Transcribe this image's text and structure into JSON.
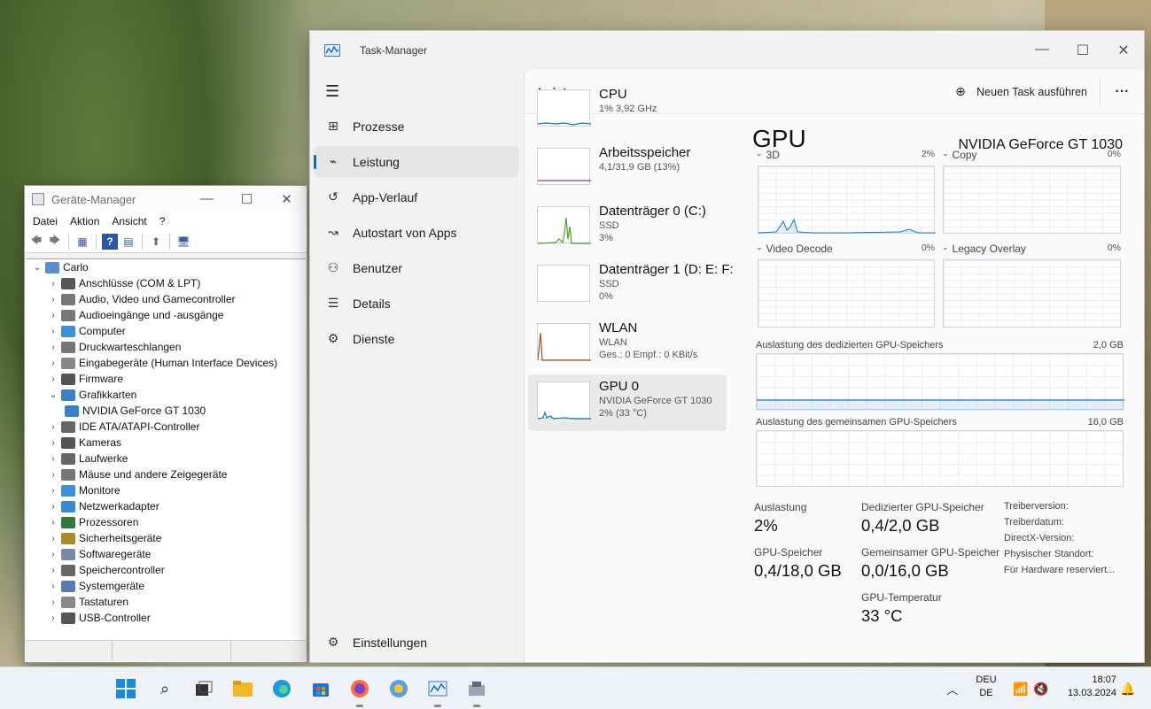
{
  "devmgr": {
    "title": "Geräte-Manager",
    "menu": [
      "Datei",
      "Aktion",
      "Ansicht",
      "?"
    ],
    "tree": [
      {
        "label": "Carlo",
        "level": 0,
        "expanded": true,
        "icon": "computer-icon"
      },
      {
        "label": "Anschlüsse (COM & LPT)",
        "level": 1,
        "icon": "port-icon"
      },
      {
        "label": "Audio, Video und Gamecontroller",
        "level": 1,
        "icon": "speaker-icon"
      },
      {
        "label": "Audioeingänge und -ausgänge",
        "level": 1,
        "icon": "speaker-icon"
      },
      {
        "label": "Computer",
        "level": 1,
        "icon": "monitor-icon"
      },
      {
        "label": "Druckwarteschlangen",
        "level": 1,
        "icon": "printer-icon"
      },
      {
        "label": "Eingabegeräte (Human Interface Devices)",
        "level": 1,
        "icon": "keyboard-icon"
      },
      {
        "label": "Firmware",
        "level": 1,
        "icon": "chip-icon"
      },
      {
        "label": "Grafikkarten",
        "level": 1,
        "expanded": true,
        "icon": "display-adapter-icon"
      },
      {
        "label": "NVIDIA GeForce GT 1030",
        "level": 2,
        "icon": "display-adapter-icon"
      },
      {
        "label": "IDE ATA/ATAPI-Controller",
        "level": 1,
        "icon": "controller-icon"
      },
      {
        "label": "Kameras",
        "level": 1,
        "icon": "camera-icon"
      },
      {
        "label": "Laufwerke",
        "level": 1,
        "icon": "drive-icon"
      },
      {
        "label": "Mäuse und andere Zeigegeräte",
        "level": 1,
        "icon": "mouse-icon"
      },
      {
        "label": "Monitore",
        "level": 1,
        "icon": "monitor-icon"
      },
      {
        "label": "Netzwerkadapter",
        "level": 1,
        "icon": "network-icon"
      },
      {
        "label": "Prozessoren",
        "level": 1,
        "icon": "cpu-icon"
      },
      {
        "label": "Sicherheitsgeräte",
        "level": 1,
        "icon": "security-icon"
      },
      {
        "label": "Softwaregeräte",
        "level": 1,
        "icon": "software-icon"
      },
      {
        "label": "Speichercontroller",
        "level": 1,
        "icon": "storage-icon"
      },
      {
        "label": "Systemgeräte",
        "level": 1,
        "icon": "system-icon"
      },
      {
        "label": "Tastaturen",
        "level": 1,
        "icon": "keyboard-icon"
      },
      {
        "label": "USB-Controller",
        "level": 1,
        "icon": "usb-icon"
      }
    ]
  },
  "taskmgr": {
    "title": "Task-Manager",
    "nav": [
      {
        "label": "Prozesse",
        "icon": "processes-icon"
      },
      {
        "label": "Leistung",
        "icon": "performance-icon",
        "active": true
      },
      {
        "label": "App-Verlauf",
        "icon": "history-icon"
      },
      {
        "label": "Autostart von Apps",
        "icon": "startup-icon"
      },
      {
        "label": "Benutzer",
        "icon": "users-icon"
      },
      {
        "label": "Details",
        "icon": "details-icon"
      },
      {
        "label": "Dienste",
        "icon": "services-icon"
      }
    ],
    "settings": "Einstellungen",
    "header": {
      "title": "Leistung",
      "new_task": "Neuen Task ausführen",
      "more": "···"
    },
    "perf_list": [
      {
        "name": "CPU",
        "sub1": "1% 3,92 GHz",
        "sub2": "",
        "sub3": "",
        "color": "#1779ba"
      },
      {
        "name": "Arbeitsspeicher",
        "sub1": "4,1/31,9 GB (13%)",
        "sub2": "",
        "sub3": "",
        "color": "#8e2aa8"
      },
      {
        "name": "Datenträger 0 (C:)",
        "sub1": "SSD",
        "sub2": "3%",
        "sub3": "",
        "color": "#4aa12c"
      },
      {
        "name": "Datenträger 1 (D: E: F:",
        "sub1": "SSD",
        "sub2": "0%",
        "sub3": "",
        "color": "#4aa12c"
      },
      {
        "name": "WLAN",
        "sub1": "WLAN",
        "sub2": "Ges.: 0 Empf.: 0 KBit/s",
        "sub3": "",
        "color": "#a0521a"
      },
      {
        "name": "GPU 0",
        "sub1": "NVIDIA GeForce GT 1030",
        "sub2": "2% (33 °C)",
        "sub3": "",
        "color": "#1779ba",
        "selected": true
      }
    ],
    "gpu": {
      "heading": "GPU",
      "model": "NVIDIA GeForce GT 1030",
      "engines": [
        {
          "label": "3D",
          "pct": "2%"
        },
        {
          "label": "Copy",
          "pct": "0%"
        },
        {
          "label": "Video Decode",
          "pct": "0%"
        },
        {
          "label": "Legacy Overlay",
          "pct": "0%"
        }
      ],
      "dedicated_label": "Auslastung des dedizierten GPU-Speichers",
      "dedicated_max": "2,0 GB",
      "shared_label": "Auslastung des gemeinsamen GPU-Speichers",
      "shared_max": "16,0 GB",
      "stats": {
        "util_label": "Auslastung",
        "util_value": "2%",
        "ded_label": "Dedizierter GPU-Speicher",
        "ded_value": "0,4/2,0 GB",
        "mem_label": "GPU-Speicher",
        "mem_value": "0,4/18,0 GB",
        "shared_label": "Gemeinsamer GPU-Speicher",
        "shared_value": "0,0/16,0 GB",
        "temp_label": "GPU-Temperatur",
        "temp_value": "33 °C"
      },
      "info": [
        "Treiberversion:",
        "Treiberdatum:",
        "DirectX-Version:",
        "Physischer Standort:",
        "Für Hardware reserviert..."
      ]
    }
  },
  "taskbar": {
    "lang1": "DEU",
    "lang2": "DE",
    "time": "18:07",
    "date": "13.03.2024"
  }
}
